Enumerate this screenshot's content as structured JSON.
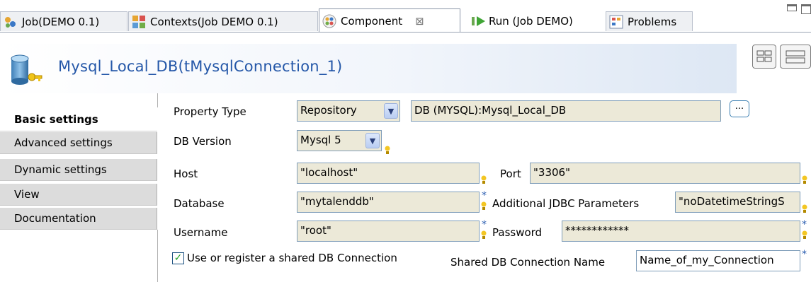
{
  "tabs": [
    {
      "label": "Job(DEMO 0.1)",
      "icon": "job-icon"
    },
    {
      "label": "Contexts(Job DEMO 0.1)",
      "icon": "contexts-icon"
    },
    {
      "label": "Component",
      "icon": "component-icon",
      "close": "⊠"
    },
    {
      "label": "Run (Job DEMO)",
      "icon": "run-icon"
    },
    {
      "label": "Problems",
      "icon": "problems-icon"
    }
  ],
  "header": {
    "title": "Mysql_Local_DB(tMysqlConnection_1)"
  },
  "nav": [
    "Basic settings",
    "Advanced settings",
    "Dynamic settings",
    "View",
    "Documentation"
  ],
  "form": {
    "property_type_label": "Property Type",
    "property_type_value": "Repository",
    "repository_value": "DB (MYSQL):Mysql_Local_DB",
    "browse_label": "...",
    "db_version_label": "DB Version",
    "db_version_value": "Mysql 5",
    "host_label": "Host",
    "host_value": "\"localhost\"",
    "port_label": "Port",
    "port_value": "\"3306\"",
    "database_label": "Database",
    "database_value": "\"mytalenddb\"",
    "jdbc_label": "Additional JDBC Parameters",
    "jdbc_value": "\"noDatetimeStringS",
    "username_label": "Username",
    "username_value": "\"root\"",
    "password_label": "Password",
    "password_value": "************",
    "shared_label": "Use or register a shared DB Connection",
    "shared_checked": true,
    "shared_name_label": "Shared DB Connection Name",
    "shared_name_value": "Name_of_my_Connection"
  },
  "colors": {
    "title": "#2457a8",
    "field_bg": "#ece9d8",
    "nav_bg": "#dcdcdc"
  }
}
